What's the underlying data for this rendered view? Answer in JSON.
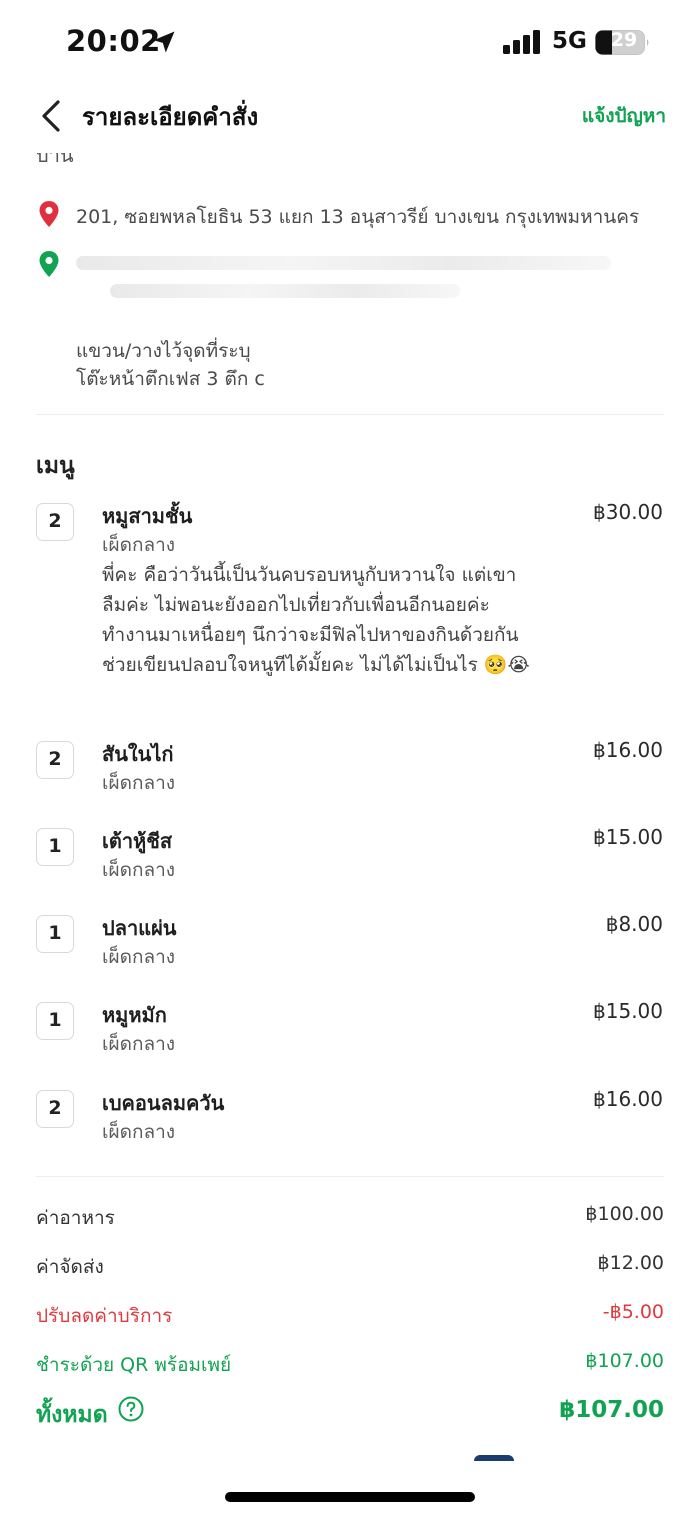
{
  "status_bar": {
    "time": "20:02",
    "network": "5G",
    "battery": "29"
  },
  "header": {
    "title": "รายละเอียดคำสั่ง",
    "report_label": "แจ้งปัญหา"
  },
  "address": {
    "cut_text": "บ้าน",
    "pickup": "201, ซอยพหลโยธิน 53 แยก 13  อนุสาวรีย์ บางเขน กรุงเทพมหานคร",
    "dropoff_blurred": "",
    "note_line1": "แขวน/วางไว้จุดที่ระบุ",
    "note_line2": "โต๊ะหน้าตึกเฟส 3 ตึก c"
  },
  "menu": {
    "title": "เมนู",
    "items": [
      {
        "qty": "2",
        "name": "หมูสามชั้น",
        "option": "เผ็ดกลาง",
        "note": "พี่คะ คือว่าวันนี้เป็นวันคบรอบหนูกับหวานใจ แต่เขาลืมค่ะ ไม่พอนะยังออกไปเที่ยวกับเพื่อนอีกนอยค่ะทำงานมาเหนื่อยๆ นึกว่าจะมีฟิลไปหาของกินด้วยกัน ช่วยเขียนปลอบใจหนูทีได้มั้ยคะ ไม่ได้ไม่เป็นไร 🥺😭",
        "price": "฿30.00"
      },
      {
        "qty": "2",
        "name": "สันในไก่",
        "option": "เผ็ดกลาง",
        "price": "฿16.00"
      },
      {
        "qty": "1",
        "name": "เต้าหู้ชีส",
        "option": "เผ็ดกลาง",
        "price": "฿15.00"
      },
      {
        "qty": "1",
        "name": "ปลาแผ่น",
        "option": "เผ็ดกลาง",
        "price": "฿8.00"
      },
      {
        "qty": "1",
        "name": "หมูหมัก",
        "option": "เผ็ดกลาง",
        "price": "฿15.00"
      },
      {
        "qty": "2",
        "name": "เบคอนลมควัน",
        "option": "เผ็ดกลาง",
        "price": "฿16.00"
      }
    ]
  },
  "summary": {
    "food_label": "ค่าอาหาร",
    "food_value": "฿100.00",
    "delivery_label": "ค่าจัดส่ง",
    "delivery_value": "฿12.00",
    "discount_label": "ปรับลดค่าบริการ",
    "discount_value": "-฿5.00",
    "payment_label": "ชำระด้วย QR พร้อมเพย์",
    "payment_value": "฿107.00",
    "total_label": "ทั้งหมด",
    "total_value": "฿107.00"
  },
  "colors": {
    "accent_green": "#12a352",
    "discount_red": "#e03a3e",
    "pickup_pin": "#e0303f",
    "dropoff_pin": "#12a352"
  },
  "icons": [
    "location-arrow-icon",
    "signal-icon",
    "battery-icon",
    "back-chevron-icon",
    "pickup-pin-icon",
    "dropoff-pin-icon",
    "help-circle-icon"
  ]
}
